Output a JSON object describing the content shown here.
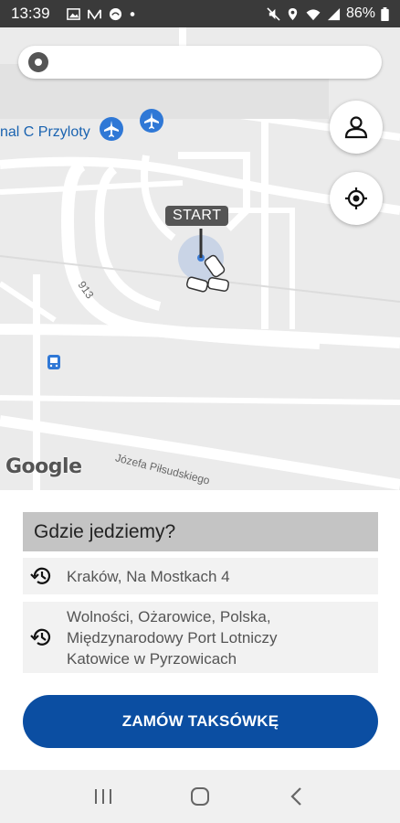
{
  "status_bar": {
    "time": "13:39",
    "battery": "86%",
    "left_icons": [
      "image-icon",
      "mail-icon",
      "weather-icon",
      "dot-icon"
    ],
    "right_icons": [
      "mute-icon",
      "location-icon",
      "wifi-icon",
      "signal-icon",
      "battery-icon"
    ]
  },
  "search": {
    "value": "",
    "placeholder": ""
  },
  "map": {
    "terminal_label": "nal C Przyloty",
    "road_913": "913",
    "street_label": "Józefa Piłsudskiego",
    "start_label": "START",
    "google_label": "Google",
    "buttons": [
      "profile-icon",
      "my-location-icon"
    ]
  },
  "panel": {
    "title": "Gdzie jedziemy?",
    "history": [
      {
        "icon": "history-icon",
        "text": "Kraków, Na Mostkach 4"
      },
      {
        "icon": "history-icon",
        "text": "Wolności, Ożarowice, Polska, Międzynarodowy Port Lotniczy Katowice w Pyrzowicach"
      }
    ],
    "order_button": "ZAMÓW TAKSÓWKĘ"
  },
  "nav_bar": {
    "buttons": [
      "recent-apps-icon",
      "home-icon",
      "back-icon"
    ]
  },
  "colors": {
    "accent": "#0b4ea2",
    "map_bg": "#ebebeb",
    "status_bar": "#3a3a3a"
  }
}
